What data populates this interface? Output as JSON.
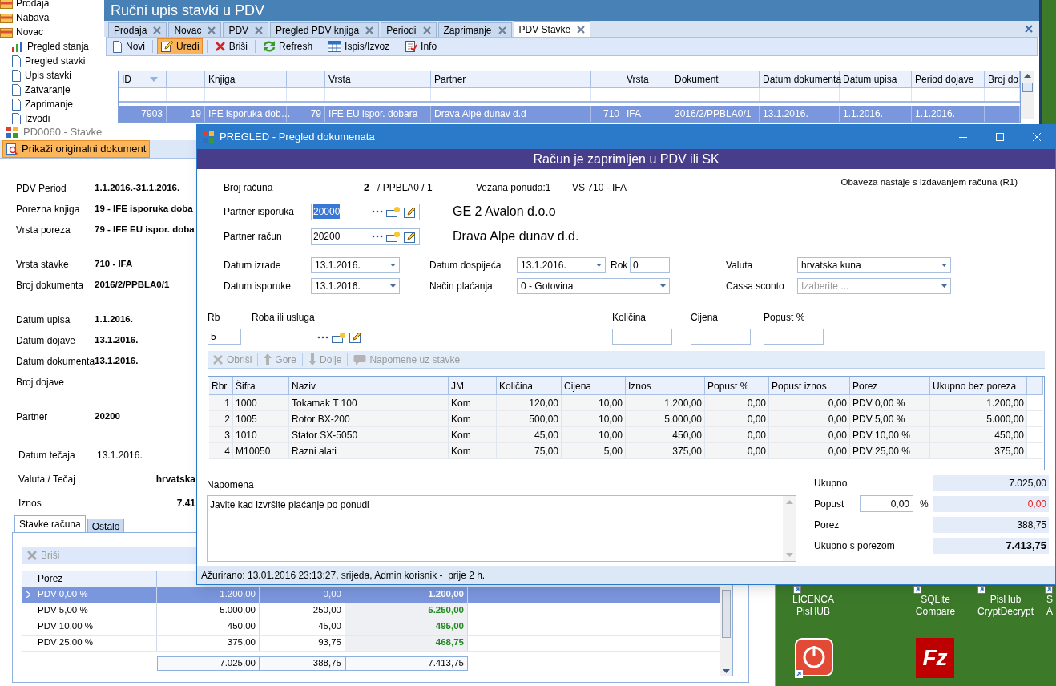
{
  "nav_tree": [
    {
      "label": "Prodaja",
      "kind": "folder"
    },
    {
      "label": "Nabava",
      "kind": "folder"
    },
    {
      "label": "Novac",
      "kind": "folder",
      "children": [
        {
          "label": "Pregled stanja",
          "kind": "chart"
        },
        {
          "label": "Pregled stavki",
          "kind": "page"
        },
        {
          "label": "Upis stavki",
          "kind": "page"
        },
        {
          "label": "Zatvaranje",
          "kind": "page"
        },
        {
          "label": "Zaprimanje",
          "kind": "page"
        },
        {
          "label": "Izvodi",
          "kind": "page"
        }
      ]
    }
  ],
  "main_window": {
    "title": "Ručni upis stavki u PDV",
    "tabs": [
      {
        "label": "Prodaja",
        "selected": false
      },
      {
        "label": "Novac",
        "selected": false
      },
      {
        "label": "PDV",
        "selected": false
      },
      {
        "label": "Pregled PDV knjiga",
        "selected": false
      },
      {
        "label": "Periodi",
        "selected": false
      },
      {
        "label": "Zaprimanje",
        "selected": false
      },
      {
        "label": "PDV Stavke",
        "selected": true
      }
    ],
    "toolbar": [
      {
        "label": "Novi",
        "kind": "new",
        "selected": false
      },
      {
        "label": "Uredi",
        "kind": "edit",
        "selected": true
      },
      {
        "label": "Briši",
        "kind": "delete",
        "selected": false
      },
      {
        "label": "Refresh",
        "kind": "refresh",
        "selected": false
      },
      {
        "label": "Ispis/Izvoz",
        "kind": "export",
        "selected": false
      },
      {
        "label": "Info",
        "kind": "info",
        "selected": false
      }
    ],
    "grid": {
      "columns": [
        "ID",
        null,
        "Knjiga",
        null,
        "Vrsta",
        "Partner",
        null,
        "Vrsta",
        "Dokument",
        "Datum dokumenta",
        "Datum upisa",
        "Period dojave",
        "Broj do"
      ],
      "rows": [
        {
          "selected": true,
          "cells": [
            "7903",
            "19",
            "IFE isporuka dob…",
            "79",
            "IFE EU ispor. dobara",
            "Drava Alpe dunav d.d",
            "710",
            "IFA",
            "2016/2/PPBLA0/1",
            "13.1.2016.",
            "1.1.2016.",
            "1.1.2016.",
            null
          ]
        }
      ]
    }
  },
  "stavke_window": {
    "title": "PD0060 - Stavke",
    "action": "Prikaži originalni dokument",
    "field_groups": [
      [
        {
          "label": "PDV Period",
          "value": "1.1.2016.-31.1.2016.",
          "kind": "bold"
        },
        {
          "label": "Porezna knjiga",
          "value": "19 - IFE isporuka doba",
          "kind": "bold"
        },
        {
          "label": "Vrsta poreza",
          "value": "79 - IFE EU ispor. doba",
          "kind": "bold"
        }
      ],
      [
        {
          "label": "Vrsta stavke",
          "value": "710 - IFA",
          "kind": "bold"
        },
        {
          "label": "Broj dokumenta",
          "value": "2016/2/PPBLA0/1",
          "kind": "bold"
        }
      ],
      [
        {
          "label": "Datum upisa",
          "value": "1.1.2016.",
          "kind": "bold"
        },
        {
          "label": "Datum dojave",
          "value": "13.1.2016.",
          "kind": "bold"
        },
        {
          "label": "Datum dokumenta",
          "value": "13.1.2016.",
          "kind": "bold"
        },
        {
          "label": "Broj dojave"
        }
      ],
      [
        {
          "label": "Partner",
          "value": "20200",
          "kind": "bold"
        }
      ],
      [
        {
          "label": "Datum tečaja",
          "value": "13.1.2016.",
          "kind": "plain"
        },
        {
          "label": "Valuta / Tečaj",
          "value": "hrvatska",
          "kind": "right"
        },
        {
          "label": "Iznos",
          "value": "7.41",
          "kind": "right"
        }
      ]
    ],
    "tabs": [
      {
        "label": "Stavke računa",
        "selected": true
      },
      {
        "label": "Ostalo",
        "selected": false
      }
    ],
    "toolbar": [
      {
        "label": "Briši",
        "disabled": true
      }
    ],
    "tax_grid": {
      "columns": [
        "Porez"
      ],
      "rows": [
        {
          "selected": true,
          "cells": [
            "PDV 0,00 %",
            "1.200,00",
            "0,00",
            "1.200,00"
          ]
        },
        {
          "selected": false,
          "cells": [
            "PDV 5,00 %",
            "5.000,00",
            "250,00",
            "5.250,00"
          ]
        },
        {
          "selected": false,
          "cells": [
            "PDV 10,00 %",
            "450,00",
            "45,00",
            "495,00"
          ]
        },
        {
          "selected": false,
          "cells": [
            "PDV 25,00 %",
            "375,00",
            "93,75",
            "468,75"
          ]
        }
      ],
      "totals": [
        "7.025,00",
        "388,75",
        "7.413,75"
      ]
    }
  },
  "dialog": {
    "title": "PREGLED - Pregled dokumenata",
    "banner": "Račun je zaprimljen u PDV ili SK",
    "header": {
      "label": "Broj računa",
      "number": "2",
      "suffix": "/ PPBLA0 / 1",
      "offer": "Vezana ponuda:1",
      "type": "VS 710 - IFA",
      "note": "Obaveza nastaje s izdavanjem računa (R1)"
    },
    "partners": [
      {
        "label": "Partner isporuka",
        "value": "20000",
        "focused": true,
        "name": "GE 2 Avalon d.o.o"
      },
      {
        "label": "Partner račun",
        "value": "20200",
        "focused": false,
        "name": "Drava Alpe dunav d.d."
      }
    ],
    "dates": {
      "created_label": "Datum izrade",
      "created": "13.1.2016.",
      "delivery_label": "Datum isporuke",
      "delivery": "13.1.2016.",
      "due_label": "Datum dospijeća",
      "due": "13.1.2016.",
      "term_label": "Rok",
      "term": "0",
      "payment_label": "Način plaćanja",
      "payment": "0 - Gotovina",
      "currency_label": "Valuta",
      "currency": "hrvatska kuna",
      "discount_label": "Cassa sconto",
      "discount_placeholder": "Izaberite ..."
    },
    "entry": {
      "rb_label": "Rb",
      "rb": "5",
      "item_label": "Roba ili usluga",
      "qty_label": "Količina",
      "price_label": "Cijena",
      "disc_label": "Popust %"
    },
    "item_toolbar": [
      {
        "label": "Obriši",
        "kind": "delete",
        "disabled": true
      },
      {
        "label": "Gore",
        "kind": "up",
        "disabled": true
      },
      {
        "label": "Dolje",
        "kind": "down",
        "disabled": true
      },
      {
        "label": "Napomene uz stavke",
        "kind": "note",
        "disabled": true
      }
    ],
    "items": {
      "columns": [
        "Rbr",
        "Šifra",
        "Naziv",
        "JM",
        "Količina",
        "Cijena",
        "Iznos",
        "Popust %",
        "Popust iznos",
        "Porez",
        "Ukupno bez poreza"
      ],
      "rows": [
        [
          "1",
          "1000",
          "Tokamak T 100",
          "Kom",
          "120,00",
          "10,00",
          "1.200,00",
          "0,00",
          "0,00",
          "PDV 0,00 %",
          "1.200,00"
        ],
        [
          "2",
          "1005",
          "Rotor BX-200",
          "Kom",
          "500,00",
          "10,00",
          "5.000,00",
          "0,00",
          "0,00",
          "PDV 5,00 %",
          "5.000,00"
        ],
        [
          "3",
          "1010",
          "Stator SX-5050",
          "Kom",
          "45,00",
          "10,00",
          "450,00",
          "0,00",
          "0,00",
          "PDV 10,00 %",
          "450,00"
        ],
        [
          "4",
          "M10050",
          "Razni alati",
          "Kom",
          "75,00",
          "5,00",
          "375,00",
          "0,00",
          "0,00",
          "PDV 25,00 %",
          "375,00"
        ]
      ]
    },
    "note_label": "Napomena",
    "note": "Javite kad izvršite plaćanje po ponudi",
    "totals": [
      {
        "label": "Ukupno",
        "value": "7.025,00",
        "kind": "plain"
      },
      {
        "label": "Popust",
        "value": "0,00",
        "kind": "discount",
        "input": "0,00",
        "unit": "%"
      },
      {
        "label": "Porez",
        "value": "388,75",
        "kind": "plain"
      },
      {
        "label": "Ukupno s porezom",
        "value": "7.413,75",
        "kind": "bold"
      }
    ],
    "status": "Ažurirano: 13.01.2016 23:13:27, srijeda, Admin korisnik -  prije 2 h."
  },
  "desktop_icons": [
    {
      "kind": "shortcut",
      "lines": [
        "LICENCA",
        "PisHUB"
      ]
    },
    {
      "kind": "shortcut",
      "lines": [
        "SQLite",
        "Compare"
      ]
    },
    {
      "kind": "shortcut",
      "lines": [
        "PisHub",
        "CryptDecrypt"
      ]
    },
    {
      "kind": "shortcut",
      "lines": [
        "S",
        "A"
      ]
    },
    {
      "kind": "power"
    },
    {
      "kind": "filezilla",
      "glyph": "Fz"
    }
  ]
}
